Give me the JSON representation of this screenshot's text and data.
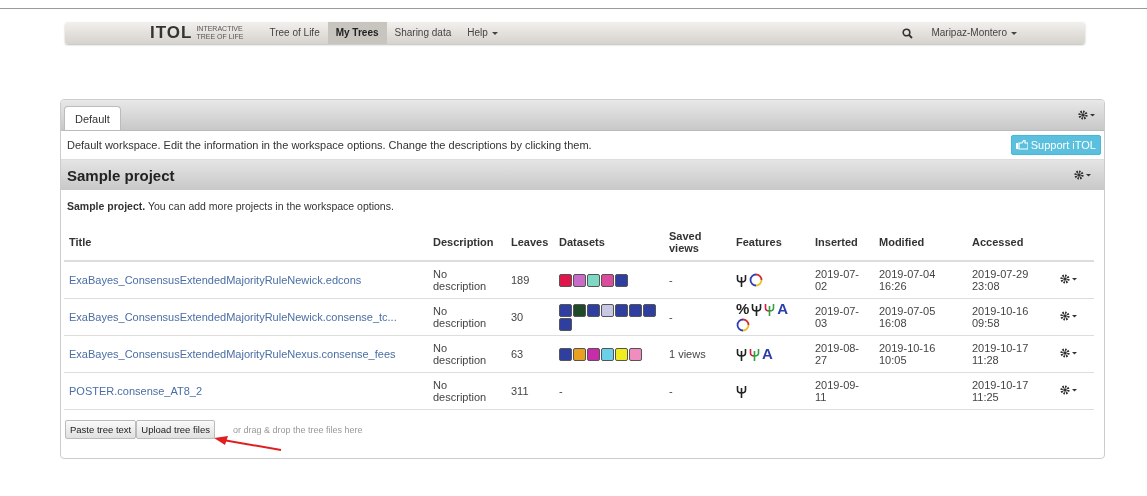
{
  "navbar": {
    "logo": "ITOL",
    "logo_sub": [
      "INTERACTIVE",
      "TREE OF LIFE"
    ],
    "links": [
      {
        "label": "Tree of Life",
        "selected": false,
        "dropdown": false
      },
      {
        "label": "My Trees",
        "selected": true,
        "dropdown": false
      },
      {
        "label": "Sharing data",
        "selected": false,
        "dropdown": false
      },
      {
        "label": "Help",
        "selected": false,
        "dropdown": true
      }
    ],
    "user": "Maripaz-Montero"
  },
  "workspace": {
    "tabs": [
      {
        "label": "Default",
        "selected": true
      }
    ],
    "description": "Default workspace. Edit the information in the workspace options. Change the descriptions by clicking them.",
    "support_button": "Support iTOL"
  },
  "project": {
    "title": "Sample project",
    "description": "**Sample project.** You can add more projects in the workspace options.",
    "columns": [
      "Title",
      "Description",
      "Leaves",
      "Datasets",
      "Saved views",
      "Features",
      "Inserted",
      "Modified",
      "Accessed"
    ],
    "rows": [
      {
        "title": "ExaBayes_ConsensusExtendedMajorityRuleNewick.edcons",
        "description": "No description",
        "leaves": "189",
        "datasets": [
          {
            "color": "#e0164a"
          },
          {
            "color": "#c86cc8"
          },
          {
            "color": "#7ed8c4"
          },
          {
            "color": "#dc4c9c"
          },
          {
            "color": "#2e3fa0"
          }
        ],
        "datasets_empty": "",
        "saved_views": "-",
        "features": [
          {
            "kind": "tree"
          },
          {
            "kind": "ring"
          }
        ],
        "inserted": "2019-07-02",
        "modified": "2019-07-04 16:26",
        "accessed": "2019-07-29 23:08"
      },
      {
        "title": "ExaBayes_ConsensusExtendedMajorityRuleNewick.consense_tc...",
        "description": "No description",
        "leaves": "30",
        "datasets": [
          {
            "color": "#2e3fa0"
          },
          {
            "color": "#1e4a2a"
          },
          {
            "color": "#2e3fa0"
          },
          {
            "color": "#c8c8e4"
          },
          {
            "color": "#2e3fa0"
          },
          {
            "color": "#2e3fa0"
          },
          {
            "color": "#2e3fa0"
          },
          {
            "color": "#2e3fa0"
          }
        ],
        "saved_views": "-",
        "features": [
          {
            "kind": "glyph",
            "text": "%"
          },
          {
            "kind": "tree"
          },
          {
            "kind": "colored-tree"
          },
          {
            "kind": "glyph",
            "text": "A"
          },
          {
            "kind": "ring"
          }
        ],
        "inserted": "2019-07-03",
        "modified": "2019-07-05 16:08",
        "accessed": "2019-10-16 09:58"
      },
      {
        "title": "ExaBayes_ConsensusExtendedMajorityRuleNexus.consense_fees",
        "description": "No description",
        "leaves": "63",
        "datasets": [
          {
            "color": "#2e3fa0"
          },
          {
            "color": "#e8a020"
          },
          {
            "color": "#c82ca8"
          },
          {
            "color": "#6cd0e8"
          },
          {
            "color": "#f0ec20"
          },
          {
            "color": "#f08cc0"
          }
        ],
        "saved_views": "1 views",
        "features": [
          {
            "kind": "tree"
          },
          {
            "kind": "colored-tree"
          },
          {
            "kind": "glyph",
            "text": "A"
          }
        ],
        "inserted": "2019-08-27",
        "modified": "2019-10-16 10:05",
        "accessed": "2019-10-17 11:28"
      },
      {
        "title": "POSTER.consense_AT8_2",
        "description": "No description",
        "leaves": "311",
        "datasets_empty": "-",
        "saved_views": "-",
        "features": [
          {
            "kind": "tree"
          }
        ],
        "inserted": "2019-09-11",
        "accessed": "2019-10-17 11:25"
      }
    ],
    "buttons": [
      "Paste tree text",
      "Upload tree files"
    ],
    "drop_hint": "or drag & drop the tree files here"
  }
}
